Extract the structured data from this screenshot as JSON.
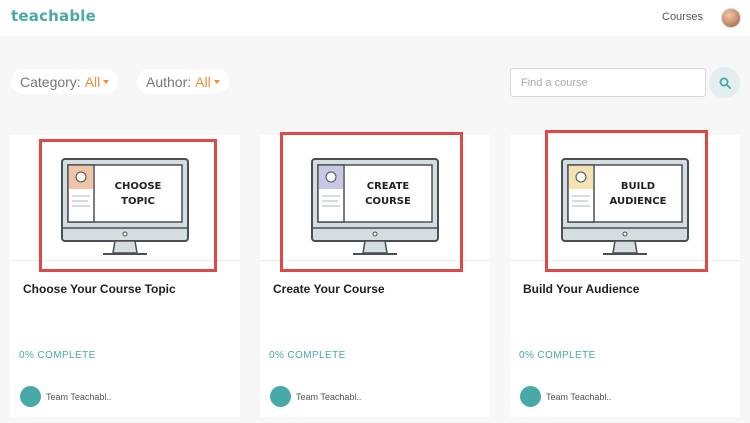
{
  "header": {
    "logo_text": "teachable",
    "nav_courses": "Courses"
  },
  "filters": {
    "category_label": "Category:",
    "category_value": "All",
    "author_label": "Author:",
    "author_value": "All"
  },
  "search": {
    "placeholder": "Find a course",
    "value": ""
  },
  "courses": [
    {
      "thumb_line1": "CHOOSE",
      "thumb_line2": "TOPIC",
      "title": "Choose Your Course Topic",
      "progress": "0% COMPLETE",
      "author": "Team Teachabl..",
      "accent": "#f0c4a6"
    },
    {
      "thumb_line1": "CREATE",
      "thumb_line2": "COURSE",
      "title": "Create Your Course",
      "progress": "0% COMPLETE",
      "author": "Team Teachabl..",
      "accent": "#c9c6e6"
    },
    {
      "thumb_line1": "BUILD",
      "thumb_line2": "AUDIENCE",
      "title": "Build Your Audience",
      "progress": "0% COMPLETE",
      "author": "Team Teachabl..",
      "accent": "#f5e2b2"
    }
  ],
  "colors": {
    "brand": "#48a9a6",
    "filter_accent": "#f28c38",
    "highlight": "#e04848"
  },
  "icons": {
    "search": "magnifier-icon",
    "author": "team-teachable-logo-icon"
  }
}
